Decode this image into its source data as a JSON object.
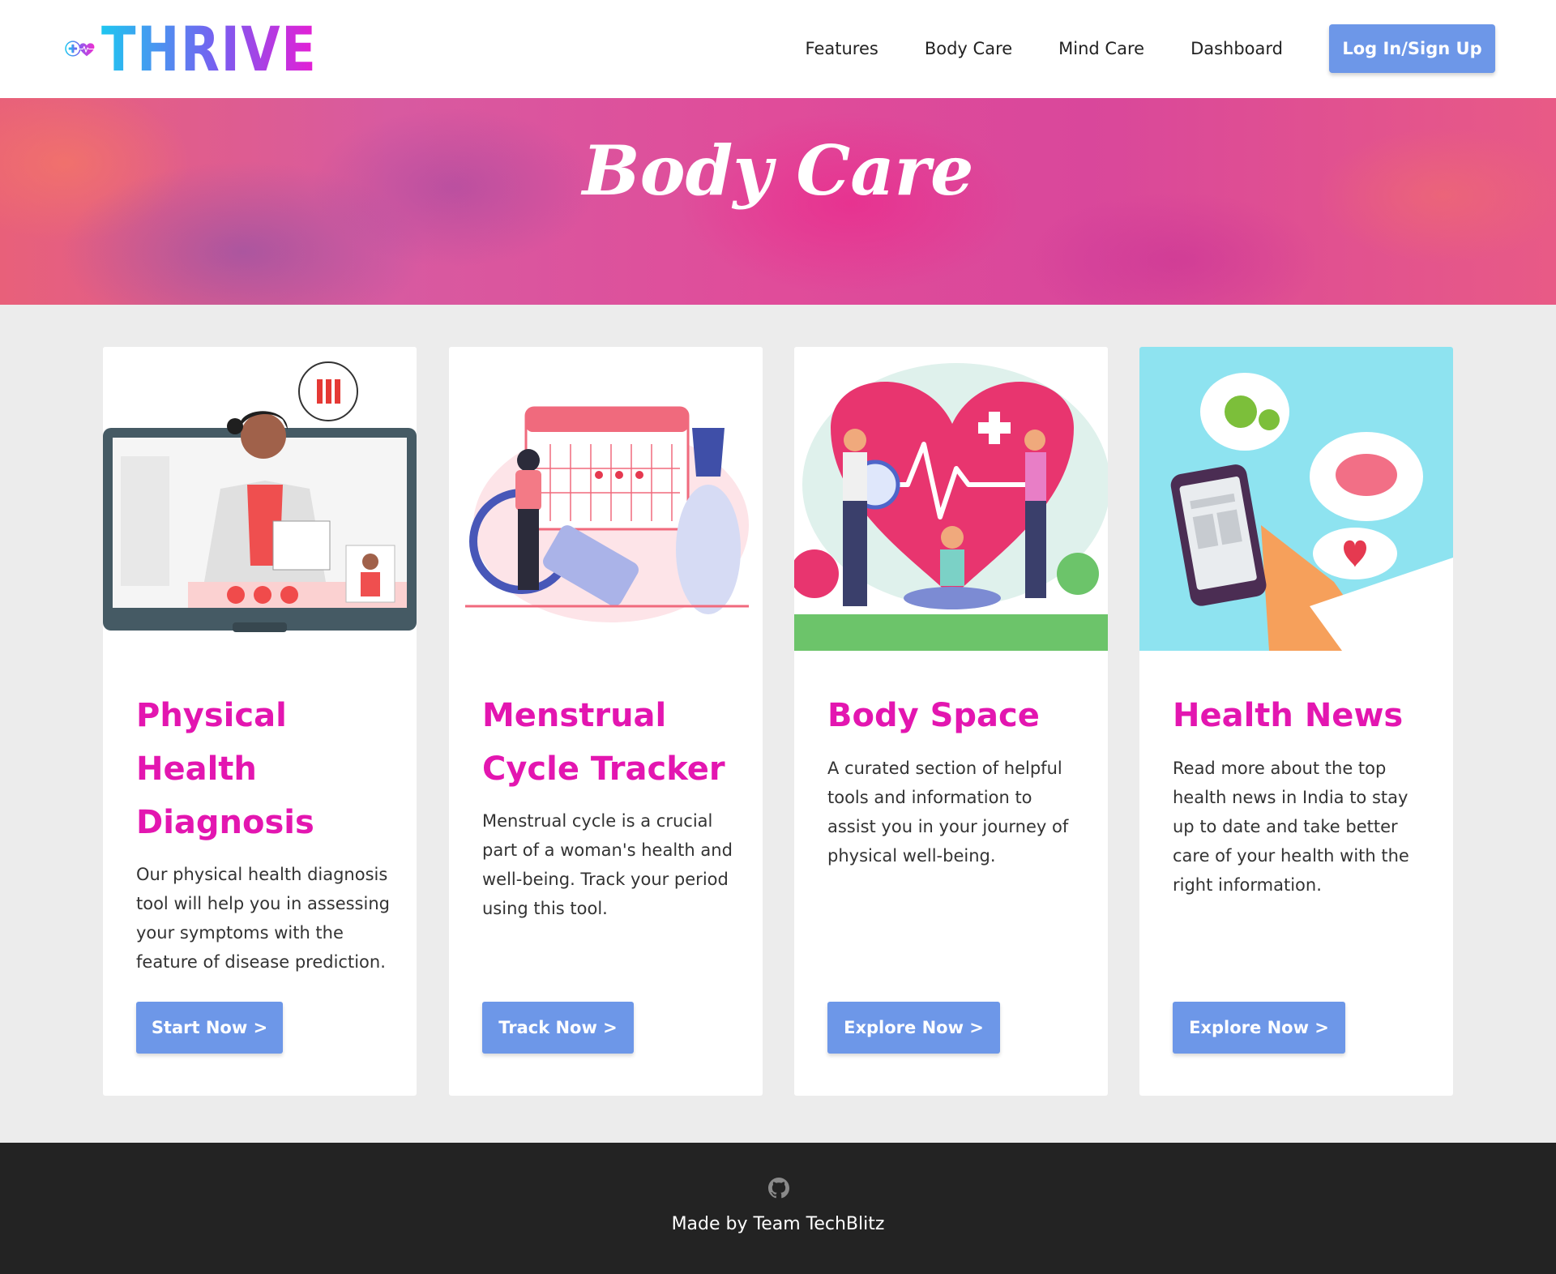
{
  "brand": {
    "name": "THRIVE",
    "gradient": [
      "#1fc6f0",
      "#7a5cf0",
      "#e81dd4"
    ]
  },
  "nav": {
    "links": [
      "Features",
      "Body Care",
      "Mind Care",
      "Dashboard"
    ],
    "login_label": "Log In/Sign Up"
  },
  "hero": {
    "title": "Body Care"
  },
  "cards": [
    {
      "title": "Physical Health Diagnosis",
      "description": "Our physical health diagnosis tool will help you in assessing your symptoms with the feature of disease prediction.",
      "button": "Start Now >"
    },
    {
      "title": "Menstrual Cycle Tracker",
      "description": "Menstrual cycle is a crucial part of a woman's health and well-being. Track your period using this tool.",
      "button": "Track Now >"
    },
    {
      "title": "Body Space",
      "description": "A curated section of helpful tools and information to assist you in your journey of physical well-being.",
      "button": "Explore Now >"
    },
    {
      "title": "Health News",
      "description": "Read more about the top health news in India to stay up to date and take better care of your health with the right information.",
      "button": "Explore Now >"
    }
  ],
  "footer": {
    "text": "Made by Team TechBlitz",
    "icon": "github-icon"
  },
  "colors": {
    "accent_button": "#6d97e8",
    "title_pink": "#e316b0",
    "footer_bg": "#232323",
    "page_bg": "#ececec"
  }
}
